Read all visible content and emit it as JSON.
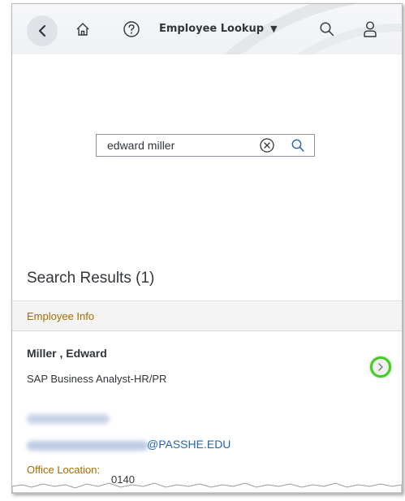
{
  "header": {
    "title": "Employee Lookup",
    "caret": "▼",
    "icons": [
      "back-icon",
      "home-icon",
      "help-icon",
      "search-icon",
      "user-icon"
    ]
  },
  "search": {
    "value": "edward miller",
    "placeholder": ""
  },
  "results": {
    "title": "Search Results (1)",
    "group_label": "Employee Info",
    "items": [
      {
        "name": "Miller , Edward",
        "job_title": "SAP Business Analyst-HR/PR",
        "email_domain": "@PASSHE.EDU",
        "office_label": "Office Location:",
        "office_value": "0140"
      }
    ]
  },
  "colors": {
    "accent_gold": "#a56c00",
    "link_blue": "#2467b0",
    "highlight_green": "#3fcf1e",
    "text": "#32363a"
  }
}
